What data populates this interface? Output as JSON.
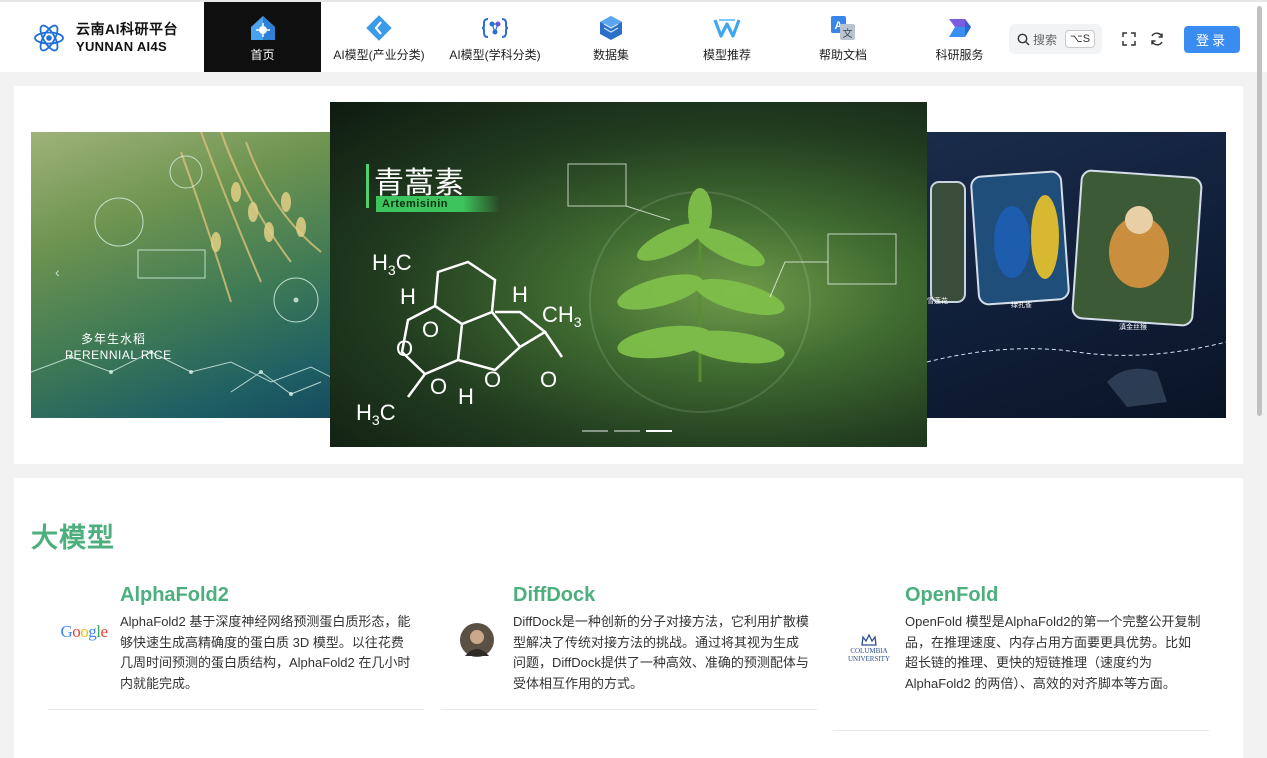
{
  "brand": {
    "name_cn": "云南AI科研平台",
    "name_en": "YUNNAN AI4S"
  },
  "nav": [
    {
      "label": "首页",
      "icon": "home-icon",
      "active": true
    },
    {
      "label": "AI模型(产业分类)",
      "icon": "industry-model-icon"
    },
    {
      "label": "AI模型(学科分类)",
      "icon": "discipline-model-icon"
    },
    {
      "label": "数据集",
      "icon": "dataset-icon"
    },
    {
      "label": "模型推荐",
      "icon": "recommend-icon"
    },
    {
      "label": "帮助文档",
      "icon": "help-docs-icon"
    },
    {
      "label": "科研服务",
      "icon": "research-service-icon"
    }
  ],
  "search": {
    "placeholder": "搜索",
    "shortcut": "⌥S"
  },
  "login_label": "登录",
  "carousel": {
    "left": {
      "title_cn": "多年生水稻",
      "title_en": "PERENNIAL RICE"
    },
    "center": {
      "title_cn": "青蒿素",
      "title_en": "Artemisinin"
    },
    "right": {
      "labels": [
        "绿孔雀",
        "滇金丝猴",
        "雪莲花"
      ]
    },
    "dots": 3,
    "active_dot": 3
  },
  "section": {
    "title": "大模型"
  },
  "models": [
    {
      "name": "AlphaFold2",
      "logo_text": "Google",
      "desc": "AlphaFold2 基于深度神经网络预测蛋白质形态，能够快速生成高精确度的蛋白质 3D 模型。以往花费几周时间预测的蛋白质结构，AlphaFold2 在几小时内就能完成。"
    },
    {
      "name": "DiffDock",
      "logo_text": "",
      "desc": "DiffDock是一种创新的分子对接方法，它利用扩散模型解决了传统对接方法的挑战。通过将其视为生成问题，DiffDock提供了一种高效、准确的预测配体与受体相互作用的方式。"
    },
    {
      "name": "OpenFold",
      "logo_text": "Columbia University",
      "desc": "OpenFold 模型是AlphaFold2的第一个完整公开复制品，在推理速度、内存占用方面要更具优势。比如超长链的推理、更快的短链推理（速度约为 AlphaFold2 的两倍）、高效的对齐脚本等方面。"
    }
  ],
  "colors": {
    "accent": "#4caf7d",
    "login": "#3b8cf0",
    "active_nav": "#0f0f0f"
  }
}
